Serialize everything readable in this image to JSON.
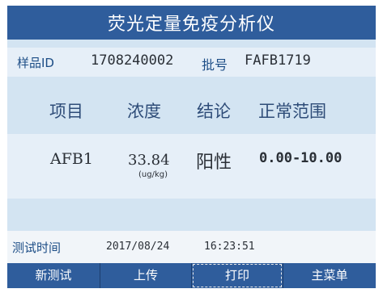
{
  "title": "荧光定量免疫分析仪",
  "info": {
    "sample_label": "样品ID",
    "sample_value": "1708240002",
    "batch_label": "批号",
    "batch_value": "FAFB1719"
  },
  "table": {
    "headers": [
      "项目",
      "浓度",
      "结论",
      "正常范围"
    ],
    "row": {
      "item": "AFB1",
      "concentration": "33.84",
      "unit": "(ug/kg)",
      "conclusion": "阳性",
      "range": "0.00-10.00"
    }
  },
  "test_time": {
    "label": "测试时间",
    "date": "2017/08/24",
    "time": "16:23:51"
  },
  "nav": [
    {
      "label": "新测试",
      "icon": "new-test-icon"
    },
    {
      "label": "上传",
      "icon": "upload-icon"
    },
    {
      "label": "打印",
      "icon": "printer-icon",
      "selected": true
    },
    {
      "label": "主菜单",
      "icon": "main-menu-icon"
    }
  ],
  "colors": {
    "bar_blue": "#2f5d9c",
    "content_bg": "#d3e4f2",
    "band_bg": "#e6eff8",
    "label_blue": "#1c4d86"
  }
}
